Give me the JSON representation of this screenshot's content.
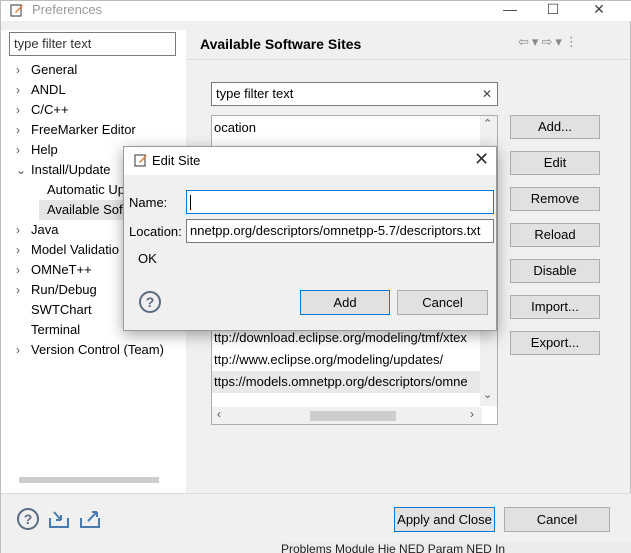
{
  "window": {
    "title": "Preferences",
    "minimize": "—",
    "maximize": "☐",
    "close": "✕"
  },
  "filter_left": {
    "placeholder": "type filter text"
  },
  "tree": [
    {
      "label": "General",
      "expandable": true
    },
    {
      "label": "ANDL",
      "expandable": true
    },
    {
      "label": "C/C++",
      "expandable": true
    },
    {
      "label": "FreeMarker Editor",
      "expandable": true
    },
    {
      "label": "Help",
      "expandable": true
    },
    {
      "label": "Install/Update",
      "expandable": true,
      "expanded": true
    },
    {
      "label": "Automatic Up",
      "child": true
    },
    {
      "label": "Available Sof",
      "child": true,
      "selected": true
    },
    {
      "label": "Java",
      "expandable": true
    },
    {
      "label": "Model Validatio",
      "expandable": true
    },
    {
      "label": "OMNeT++",
      "expandable": true
    },
    {
      "label": "Run/Debug",
      "expandable": true
    },
    {
      "label": "SWTChart",
      "expandable": false
    },
    {
      "label": "Terminal",
      "expandable": false
    },
    {
      "label": "Version Control (Team)",
      "expandable": true
    }
  ],
  "page": {
    "title": "Available Software Sites",
    "filter_placeholder": "type filter text",
    "filter_clear": "✕"
  },
  "sites_table": {
    "header": "ocation",
    "rows": [
      "ttp://download.eclipse.org/modeling/tmf/xtex",
      "ttp://www.eclipse.org/modeling/updates/",
      "ttps://models.omnetpp.org/descriptors/omne"
    ],
    "selected_index": 2
  },
  "side_buttons": [
    "Add...",
    "Edit",
    "Remove",
    "Reload",
    "Disable",
    "Import...",
    "Export..."
  ],
  "bottom": {
    "apply_close": "Apply and Close",
    "cancel": "Cancel"
  },
  "taskbar": {
    "text": "Problems   Module Hie   NED Param   NED In"
  },
  "dialog": {
    "title": "Edit Site",
    "close": "✕",
    "name_label": "Name:",
    "name_value": "",
    "location_label": "Location:",
    "location_value": "nnetpp.org/descriptors/omnetpp-5.7/descriptors.txt",
    "status": "OK",
    "add": "Add",
    "cancel": "Cancel"
  },
  "colors": {
    "focus": "#0078d7",
    "selection": "#e5e5e5"
  }
}
